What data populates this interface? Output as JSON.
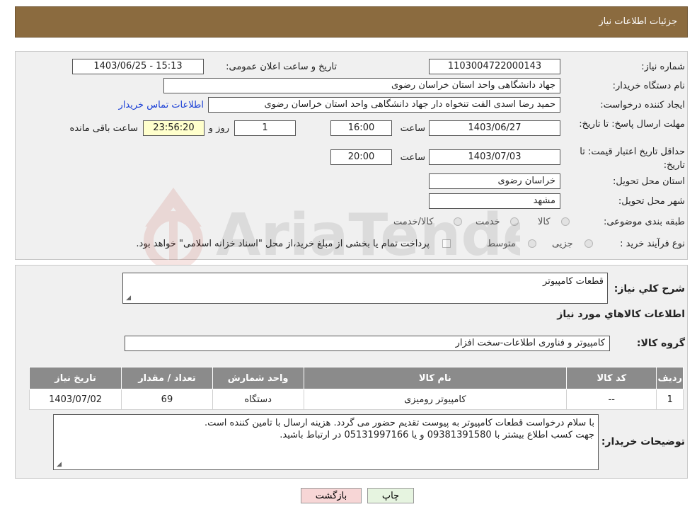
{
  "header": {
    "title": "جزئیات اطلاعات نیاز"
  },
  "details": {
    "need_number_label": "شماره نیاز:",
    "need_number": "1103004722000143",
    "announce_label": "تاریخ و ساعت اعلان عمومی:",
    "announce_value": "1403/06/25 - 15:13",
    "buyer_org_label": "نام دستگاه خریدار:",
    "buyer_org": "جهاد دانشگاهی واحد استان خراسان رضوی",
    "requester_label": "ایجاد کننده درخواست:",
    "requester": "حمید رضا اسدی الفت تنخواه دار جهاد دانشگاهی واحد استان خراسان رضوی",
    "buyer_contact_link": "اطلاعات تماس خریدار",
    "reply_deadline_label": "مهلت ارسال پاسخ: تا تاریخ:",
    "reply_date": "1403/06/27",
    "time_label": "ساعت",
    "reply_time": "16:00",
    "days_value": "1",
    "days_label": "روز و",
    "remaining_time": "23:56:20",
    "remaining_label": "ساعت باقی مانده",
    "price_validity_label": "حداقل تاریخ اعتبار قیمت: تا تاریخ:",
    "price_validity_date": "1403/07/03",
    "price_validity_time": "20:00",
    "province_label": "استان محل تحویل:",
    "province": "خراسان رضوی",
    "city_label": "شهر محل تحویل:",
    "city": "مشهد",
    "category_label": "طبقه بندی موضوعی:",
    "category_options": [
      "کالا",
      "خدمت",
      "کالا/خدمت"
    ],
    "process_label": "نوع فرآیند خرید :",
    "process_options": [
      "جزیی",
      "متوسط"
    ],
    "payment_note": "پرداخت تمام یا بخشی از مبلغ خرید،از محل \"اسناد خزانه اسلامی\" خواهد بود."
  },
  "summary": {
    "general_desc_label": "شرح کلي نياز:",
    "general_desc": "قطعات کامپیوتر",
    "goods_info_title": "اطلاعات کالاهاي مورد نياز",
    "goods_group_label": "گروه کالا:",
    "goods_group": "کامپیوتر و فناوری اطلاعات-سخت افزار"
  },
  "goods_table": {
    "headers": [
      "ردیف",
      "کد کالا",
      "نام کالا",
      "واحد شمارش",
      "تعداد / مقدار",
      "تاریخ نیاز"
    ],
    "rows": [
      [
        "1",
        "--",
        "کامپیوتر رومیزی",
        "دستگاه",
        "69",
        "1403/07/02"
      ]
    ]
  },
  "buyer_notes": {
    "label": "توضیحات خریدار:",
    "line1": "با سلام درخواست قطعات کامپیوتر به پیوست تقدیم حضور می گردد. هزینه ارسال با تامین کننده است.",
    "line2": "جهت کسب اطلاع بیشتر با 09381391580 و یا 05131997166  در ارتباط باشید."
  },
  "buttons": {
    "print": "چاپ",
    "back": "بازگشت"
  },
  "watermark": {
    "text": "AriaTender.neT"
  },
  "colors": {
    "header_bg": "#8b6b3f",
    "table_header_bg": "#8b8b8b",
    "remaining_bg": "#ffffcc",
    "back_btn_bg": "#f7d6d6",
    "print_btn_bg": "#e6f4e0",
    "link": "#1a3fd6"
  }
}
